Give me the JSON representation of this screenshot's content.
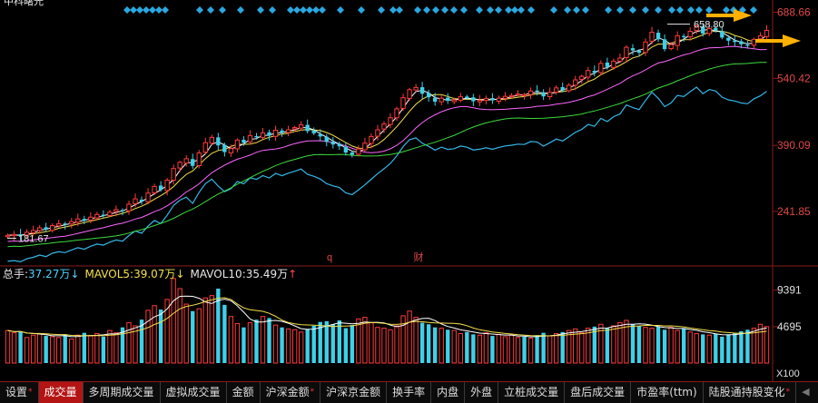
{
  "window": {
    "title": "中科曙光"
  },
  "price_axis": {
    "labels": [
      "688.66",
      "540.42",
      "390.09",
      "241.85"
    ],
    "values": [
      688.66,
      540.42,
      390.09,
      241.85
    ]
  },
  "volume_axis": {
    "labels": [
      "9391",
      "4695",
      "X100"
    ],
    "values": [
      9391,
      4695
    ]
  },
  "annotations": {
    "low_label": "181.67",
    "high_label": "658.80",
    "marker_q": "q",
    "marker_cai": "财"
  },
  "volume_legend": {
    "total_label": "总手:",
    "total_value": "37.27万",
    "total_arrow": "↓",
    "mavol5_label": "MAVOL5:",
    "mavol5_value": "39.07万",
    "mavol5_arrow": "↓",
    "mavol10_label": "MAVOL10:",
    "mavol10_value": "35.49万",
    "mavol10_arrow": "↑"
  },
  "tabs": [
    {
      "label": "设置",
      "superscript": "*"
    },
    {
      "label": "成交量",
      "superscript": "",
      "active": true
    },
    {
      "label": "多周期成交量",
      "superscript": ""
    },
    {
      "label": "虚拟成交量",
      "superscript": ""
    },
    {
      "label": "金额",
      "superscript": ""
    },
    {
      "label": "沪深金额",
      "superscript": "*"
    },
    {
      "label": "沪深京金额",
      "superscript": ""
    },
    {
      "label": "换手率",
      "superscript": ""
    },
    {
      "label": "内盘",
      "superscript": ""
    },
    {
      "label": "外盘",
      "superscript": ""
    },
    {
      "label": "立桩成交量",
      "superscript": ""
    },
    {
      "label": "盘后成交量",
      "superscript": ""
    },
    {
      "label": "市盈率(ttm)",
      "superscript": ""
    },
    {
      "label": "陆股通持股变化",
      "superscript": "*"
    }
  ],
  "colors": {
    "up": "#ff3b3b",
    "down": "#3fd0e8",
    "ma5": "#ffffff",
    "ma10": "#f5e04a",
    "ma20": "#ff66ff",
    "ma30": "#3ddc3d",
    "ma60": "#35b7e8",
    "signal_diamond": "#2aa7e0",
    "arrow": "#ffb000",
    "axis": "#8a1b1b",
    "axis_text": "#e04848"
  },
  "chart_data": [
    {
      "type": "candlestick",
      "title": "",
      "ylim": [
        150,
        700
      ],
      "y_ticks": [
        688.66,
        540.42,
        390.09,
        241.85
      ],
      "annotations": [
        {
          "label": "181.67",
          "kind": "low"
        },
        {
          "label": "658.80",
          "kind": "high"
        }
      ],
      "close": [
        188,
        190,
        187,
        195,
        199,
        205,
        201,
        210,
        214,
        212,
        219,
        225,
        221,
        229,
        235,
        232,
        240,
        246,
        243,
        258,
        270,
        264,
        283,
        298,
        290,
        312,
        338,
        352,
        360,
        344,
        373,
        396,
        408,
        390,
        375,
        383,
        402,
        396,
        412,
        408,
        418,
        412,
        424,
        418,
        425,
        430,
        436,
        422,
        417,
        410,
        398,
        392,
        388,
        374,
        369,
        382,
        395,
        410,
        425,
        438,
        452,
        472,
        497,
        515,
        520,
        506,
        498,
        488,
        496,
        490,
        492,
        499,
        496,
        489,
        491,
        495,
        491,
        496,
        500,
        502,
        505,
        504,
        512,
        511,
        500,
        509,
        519,
        514,
        525,
        537,
        545,
        558,
        553,
        574,
        566,
        579,
        586,
        610,
        603,
        598,
        622,
        644,
        628,
        606,
        616,
        636,
        633,
        646,
        658,
        641,
        652,
        648,
        632,
        625,
        622,
        617,
        615,
        628,
        636,
        648
      ],
      "series": [
        {
          "name": "MA5",
          "color": "#ffffff"
        },
        {
          "name": "MA10",
          "color": "#f5e04a"
        },
        {
          "name": "MA20",
          "color": "#ff66ff"
        },
        {
          "name": "MA30",
          "color": "#3ddc3d"
        },
        {
          "name": "MA60",
          "color": "#35b7e8"
        }
      ]
    },
    {
      "type": "bar",
      "title": "",
      "ylim": [
        0,
        11000
      ],
      "y_ticks": [
        9391,
        4695
      ],
      "unit": "X100",
      "volume": [
        4200,
        3900,
        4100,
        3300,
        3600,
        3800,
        3500,
        3400,
        3300,
        3700,
        3100,
        3600,
        3900,
        3500,
        3800,
        3400,
        4200,
        3900,
        4600,
        5200,
        4800,
        5600,
        6800,
        7400,
        6900,
        8200,
        10900,
        9600,
        7600,
        6700,
        7000,
        8400,
        8700,
        9600,
        7500,
        6000,
        5100,
        4600,
        5200,
        5600,
        6000,
        5800,
        4900,
        4600,
        4400,
        4300,
        4000,
        4400,
        4800,
        5300,
        5400,
        5000,
        5500,
        4500,
        4900,
        5700,
        5900,
        5200,
        4600,
        4500,
        4300,
        4800,
        6100,
        6700,
        5900,
        5200,
        5000,
        4600,
        4500,
        4300,
        4200,
        3800,
        4000,
        3700,
        3600,
        3900,
        3500,
        3700,
        3400,
        3600,
        3300,
        3400,
        3200,
        3600,
        3900,
        3500,
        3800,
        4000,
        4200,
        4400,
        3900,
        4500,
        4700,
        5000,
        4500,
        4800,
        5200,
        5500,
        5000,
        4800,
        4600,
        4500,
        4700,
        4300,
        4600,
        4200,
        4500,
        4000,
        3800,
        3700,
        3600,
        3800,
        3400,
        3700,
        3900,
        4100,
        4300,
        4500,
        5000,
        4700
      ]
    }
  ]
}
